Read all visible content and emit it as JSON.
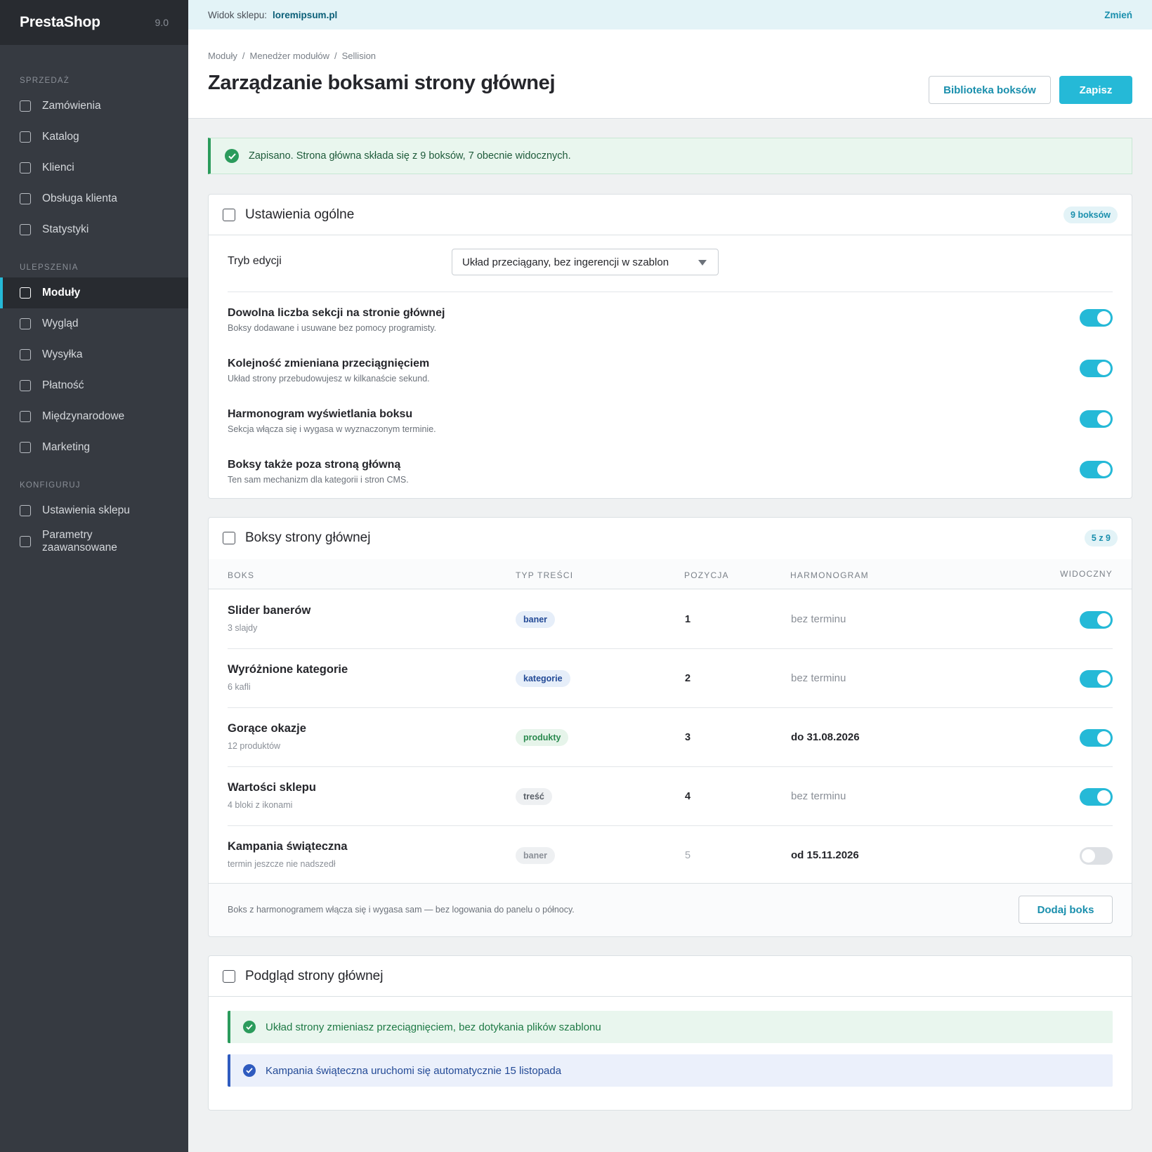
{
  "sidebar": {
    "brand": "PrestaShop",
    "version": "9.0",
    "sections": [
      {
        "title": "SPRZEDAŻ",
        "items": [
          "Zamówienia",
          "Katalog",
          "Klienci",
          "Obsługa klienta",
          "Statystyki"
        ]
      },
      {
        "title": "ULEPSZENIA",
        "items": [
          "Moduły",
          "Wygląd",
          "Wysyłka",
          "Płatność",
          "Międzynarodowe",
          "Marketing"
        ]
      },
      {
        "title": "KONFIGURUJ",
        "items": [
          "Ustawienia sklepu",
          "Parametry zaawansowane"
        ]
      }
    ],
    "active_item": "Moduły"
  },
  "topbar": {
    "shop_label": "Widok sklepu:",
    "shop_url": "loremipsum.pl",
    "change_label": "Zmień"
  },
  "header": {
    "breadcrumb": [
      "Moduły",
      "Menedżer modułów",
      "Sellision"
    ],
    "title": "Zarządzanie boksami strony głównej",
    "library_button": "Biblioteka boksów",
    "save_button": "Zapisz"
  },
  "alert": {
    "text": "Zapisano. Strona główna składa się z 9 boksów, 7 obecnie widocznych."
  },
  "general": {
    "title": "Ustawienia ogólne",
    "badge": "9 boksów",
    "edit_mode_label": "Tryb edycji",
    "edit_mode_value": "Układ przeciągany, bez ingerencji w szablon",
    "options": [
      {
        "title": "Dowolna liczba sekcji na stronie głównej",
        "desc": "Boksy dodawane i usuwane bez pomocy programisty.",
        "on": true
      },
      {
        "title": "Kolejność zmieniana przeciągnięciem",
        "desc": "Układ strony przebudowujesz w kilkanaście sekund.",
        "on": true
      },
      {
        "title": "Harmonogram wyświetlania boksu",
        "desc": "Sekcja włącza się i wygasa w wyznaczonym terminie.",
        "on": true
      },
      {
        "title": "Boksy także poza stroną główną",
        "desc": "Ten sam mechanizm dla kategorii i stron CMS.",
        "on": true
      }
    ]
  },
  "boxes": {
    "title": "Boksy strony głównej",
    "badge": "5 z 9",
    "columns": {
      "box": "BOKS",
      "type": "TYP TREŚCI",
      "position": "POZYCJA",
      "schedule": "HARMONOGRAM",
      "visible": "WIDOCZNY"
    },
    "rows": [
      {
        "name": "Slider banerów",
        "sub": "3 slajdy",
        "type": "baner",
        "type_style": "blue",
        "position": "1",
        "schedule": "bez terminu",
        "schedule_strong": false,
        "visible": true
      },
      {
        "name": "Wyróżnione kategorie",
        "sub": "6 kafli",
        "type": "kategorie",
        "type_style": "blue",
        "position": "2",
        "schedule": "bez terminu",
        "schedule_strong": false,
        "visible": true
      },
      {
        "name": "Gorące okazje",
        "sub": "12 produktów",
        "type": "produkty",
        "type_style": "green",
        "position": "3",
        "schedule": "do 31.08.2026",
        "schedule_strong": true,
        "visible": true
      },
      {
        "name": "Wartości sklepu",
        "sub": "4 bloki z ikonami",
        "type": "treść",
        "type_style": "gray",
        "position": "4",
        "schedule": "bez terminu",
        "schedule_strong": false,
        "visible": true
      },
      {
        "name": "Kampania świąteczna",
        "sub": "termin jeszcze nie nadszedł",
        "type": "baner",
        "type_style": "muted",
        "position": "5",
        "schedule": "od 15.11.2026",
        "schedule_strong": true,
        "visible": false
      }
    ],
    "footer_note": "Boks z harmonogramem włącza się i wygasa sam — bez logowania do panelu o północy.",
    "add_button": "Dodaj boks"
  },
  "preview": {
    "title": "Podgląd strony głównej",
    "notes": [
      {
        "text": "Układ strony zmieniasz przeciągnięciem, bez dotykania plików szablonu",
        "style": "green"
      },
      {
        "text": "Kampania świąteczna uruchomi się automatycznie 15 listopada",
        "style": "blue"
      }
    ]
  },
  "colors": {
    "accent": "#25b9d7",
    "sidebar": "#363a41",
    "success": "#2b9b5c",
    "info": "#2f5bbf"
  }
}
